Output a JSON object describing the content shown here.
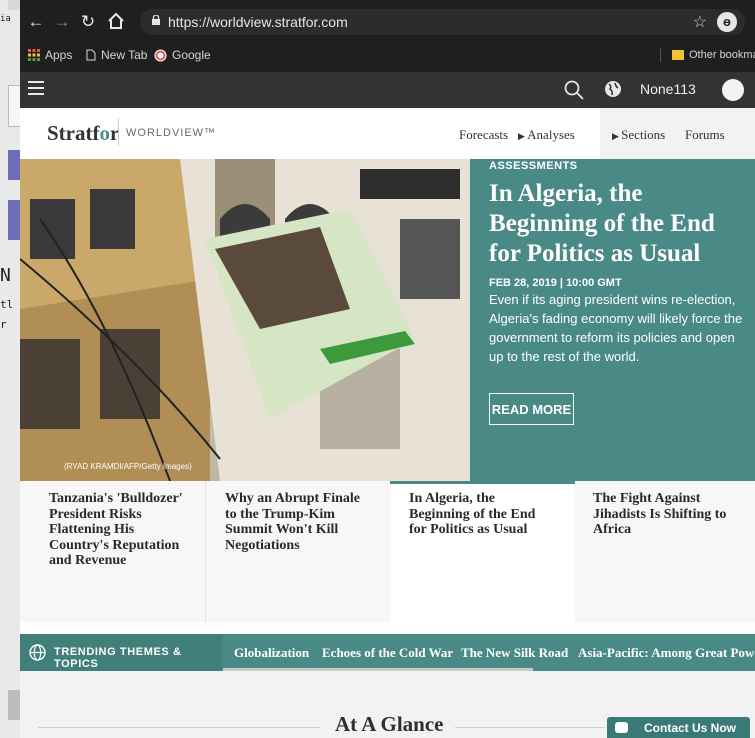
{
  "background_window": {
    "fragments": [
      "ia",
      "t",
      "N",
      "tl",
      "r"
    ]
  },
  "browser": {
    "url": "https://worldview.stratfor.com",
    "bookmarks": [
      "Apps",
      "New Tab",
      "Google",
      "Other bookmark"
    ]
  },
  "site_bar": {
    "user_label": "None113"
  },
  "site_nav": {
    "logo_main": "Stratf",
    "logo_o": "o",
    "logo_end": "r",
    "logo_sub": "WORLDVIEW™",
    "items": [
      "Forecasts",
      "Analyses",
      "Sections",
      "Forums"
    ]
  },
  "hero": {
    "kicker": "ASSESSMENTS",
    "headline": "In Algeria, the Beginning of the End for Politics as Usual",
    "dateline": "FEB 28, 2019 | 10:00 GMT",
    "summary": "Even if its aging president wins re-election, Algeria's fading economy will likely force the government to reform its policies and open up to the rest of the world.",
    "read_more": "READ MORE",
    "photo_credit": "(RYAD KRAMDI/AFP/Getty Images)"
  },
  "tiles": [
    "Tanzania's 'Bulldozer' President Risks Flattening His Country's Reputation and Revenue",
    "Why an Abrupt Finale to the Trump-Kim Summit Won't Kill Negotiations",
    "In Algeria, the Beginning of the End for Politics as Usual",
    "The Fight Against Jihadists Is Shifting to Africa"
  ],
  "trending": {
    "label": "TRENDING THEMES & TOPICS",
    "topics": [
      "Globalization",
      "Echoes of the Cold War",
      "The New Silk Road",
      "Asia-Pacific: Among Great Power"
    ]
  },
  "glance": {
    "title": "At A Glance",
    "contact": "Contact Us Now"
  },
  "colors": {
    "teal": "#4a8a86",
    "dark_bar": "#333335",
    "chrome": "#1f1f1f"
  }
}
